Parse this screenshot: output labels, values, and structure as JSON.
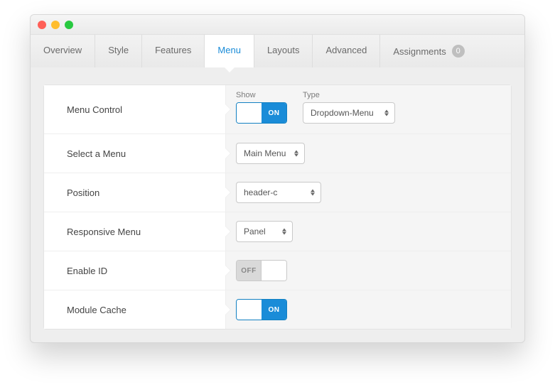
{
  "tabs": {
    "overview": "Overview",
    "style": "Style",
    "features": "Features",
    "menu": "Menu",
    "layouts": "Layouts",
    "advanced": "Advanced",
    "assignments": "Assignments",
    "assignments_badge": "0"
  },
  "rows": {
    "menu_control": {
      "label": "Menu Control",
      "show_caption": "Show",
      "show_state": "ON",
      "type_caption": "Type",
      "type_value": "Dropdown-Menu"
    },
    "select_menu": {
      "label": "Select a Menu",
      "value": "Main Menu"
    },
    "position": {
      "label": "Position",
      "value": "header-c"
    },
    "responsive_menu": {
      "label": "Responsive Menu",
      "value": "Panel"
    },
    "enable_id": {
      "label": "Enable ID",
      "state": "OFF"
    },
    "module_cache": {
      "label": "Module Cache",
      "state": "ON"
    }
  }
}
